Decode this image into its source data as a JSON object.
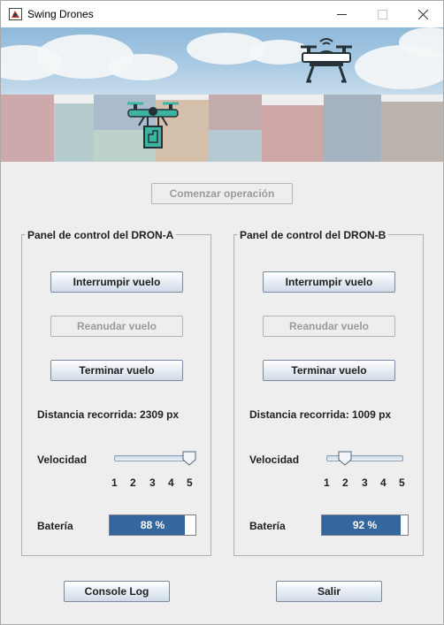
{
  "window": {
    "title": "Swing Drones"
  },
  "main": {
    "start_button": "Comenzar operación",
    "console_button": "Console Log",
    "exit_button": "Salir"
  },
  "panels": [
    {
      "title": "Panel de control del DRON-A",
      "interrupt": "Interrumpir vuelo",
      "resume": "Reanudar vuelo",
      "finish": "Terminar vuelo",
      "distance": "Distancia recorrida: 2309 px",
      "speed_label": "Velocidad",
      "speed": 5,
      "ticks": [
        "1",
        "2",
        "3",
        "4",
        "5"
      ],
      "battery_label": "Batería",
      "battery_text": "88 %",
      "battery": 0.88
    },
    {
      "title": "Panel de control del DRON-B",
      "interrupt": "Interrumpir vuelo",
      "resume": "Reanudar vuelo",
      "finish": "Terminar vuelo",
      "distance": "Distancia recorrida: 1009 px",
      "speed_label": "Velocidad",
      "speed": 2,
      "ticks": [
        "1",
        "2",
        "3",
        "4",
        "5"
      ],
      "battery_label": "Batería",
      "battery_text": "92 %",
      "battery": 0.92
    }
  ],
  "colors": {
    "battery_fill": "#36669e",
    "drone_dark": "#263238",
    "drone_teal": "#3bb5a0"
  },
  "icons": {
    "app": "app-icon",
    "minimize": "minimize-icon",
    "maximize": "maximize-icon",
    "close": "close-icon",
    "drone_a": "drone-icon",
    "drone_b": "delivery-drone-icon"
  }
}
